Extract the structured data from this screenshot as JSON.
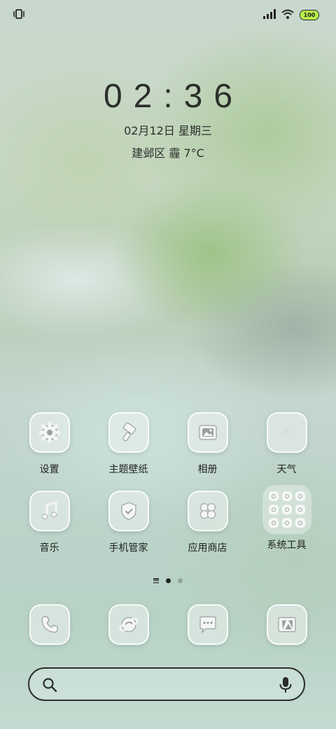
{
  "clock": {
    "time": "02:36",
    "date": "02月12日 星期三",
    "weather": "建邺区 霾 7°C"
  },
  "status_bar": {
    "battery": "100",
    "battery_color": "#b8f04a"
  },
  "apps": [
    [
      {
        "label": "设置",
        "icon": "gear-icon"
      },
      {
        "label": "主题壁纸",
        "icon": "brush-icon"
      },
      {
        "label": "相册",
        "icon": "gallery-icon"
      },
      {
        "label": "天气",
        "icon": "weather-icon",
        "badge": "7°"
      }
    ],
    [
      {
        "label": "音乐",
        "icon": "music-icon"
      },
      {
        "label": "手机管家",
        "icon": "shield-icon"
      },
      {
        "label": "应用商店",
        "icon": "app-store-icon"
      },
      {
        "label": "系统工具",
        "icon": "folder-icon"
      }
    ]
  ],
  "dock": [
    {
      "icon": "phone-icon"
    },
    {
      "icon": "browser-icon"
    },
    {
      "icon": "message-icon"
    },
    {
      "icon": "camera-icon"
    }
  ],
  "page_indicator": {
    "pages": 2,
    "active": 1
  }
}
